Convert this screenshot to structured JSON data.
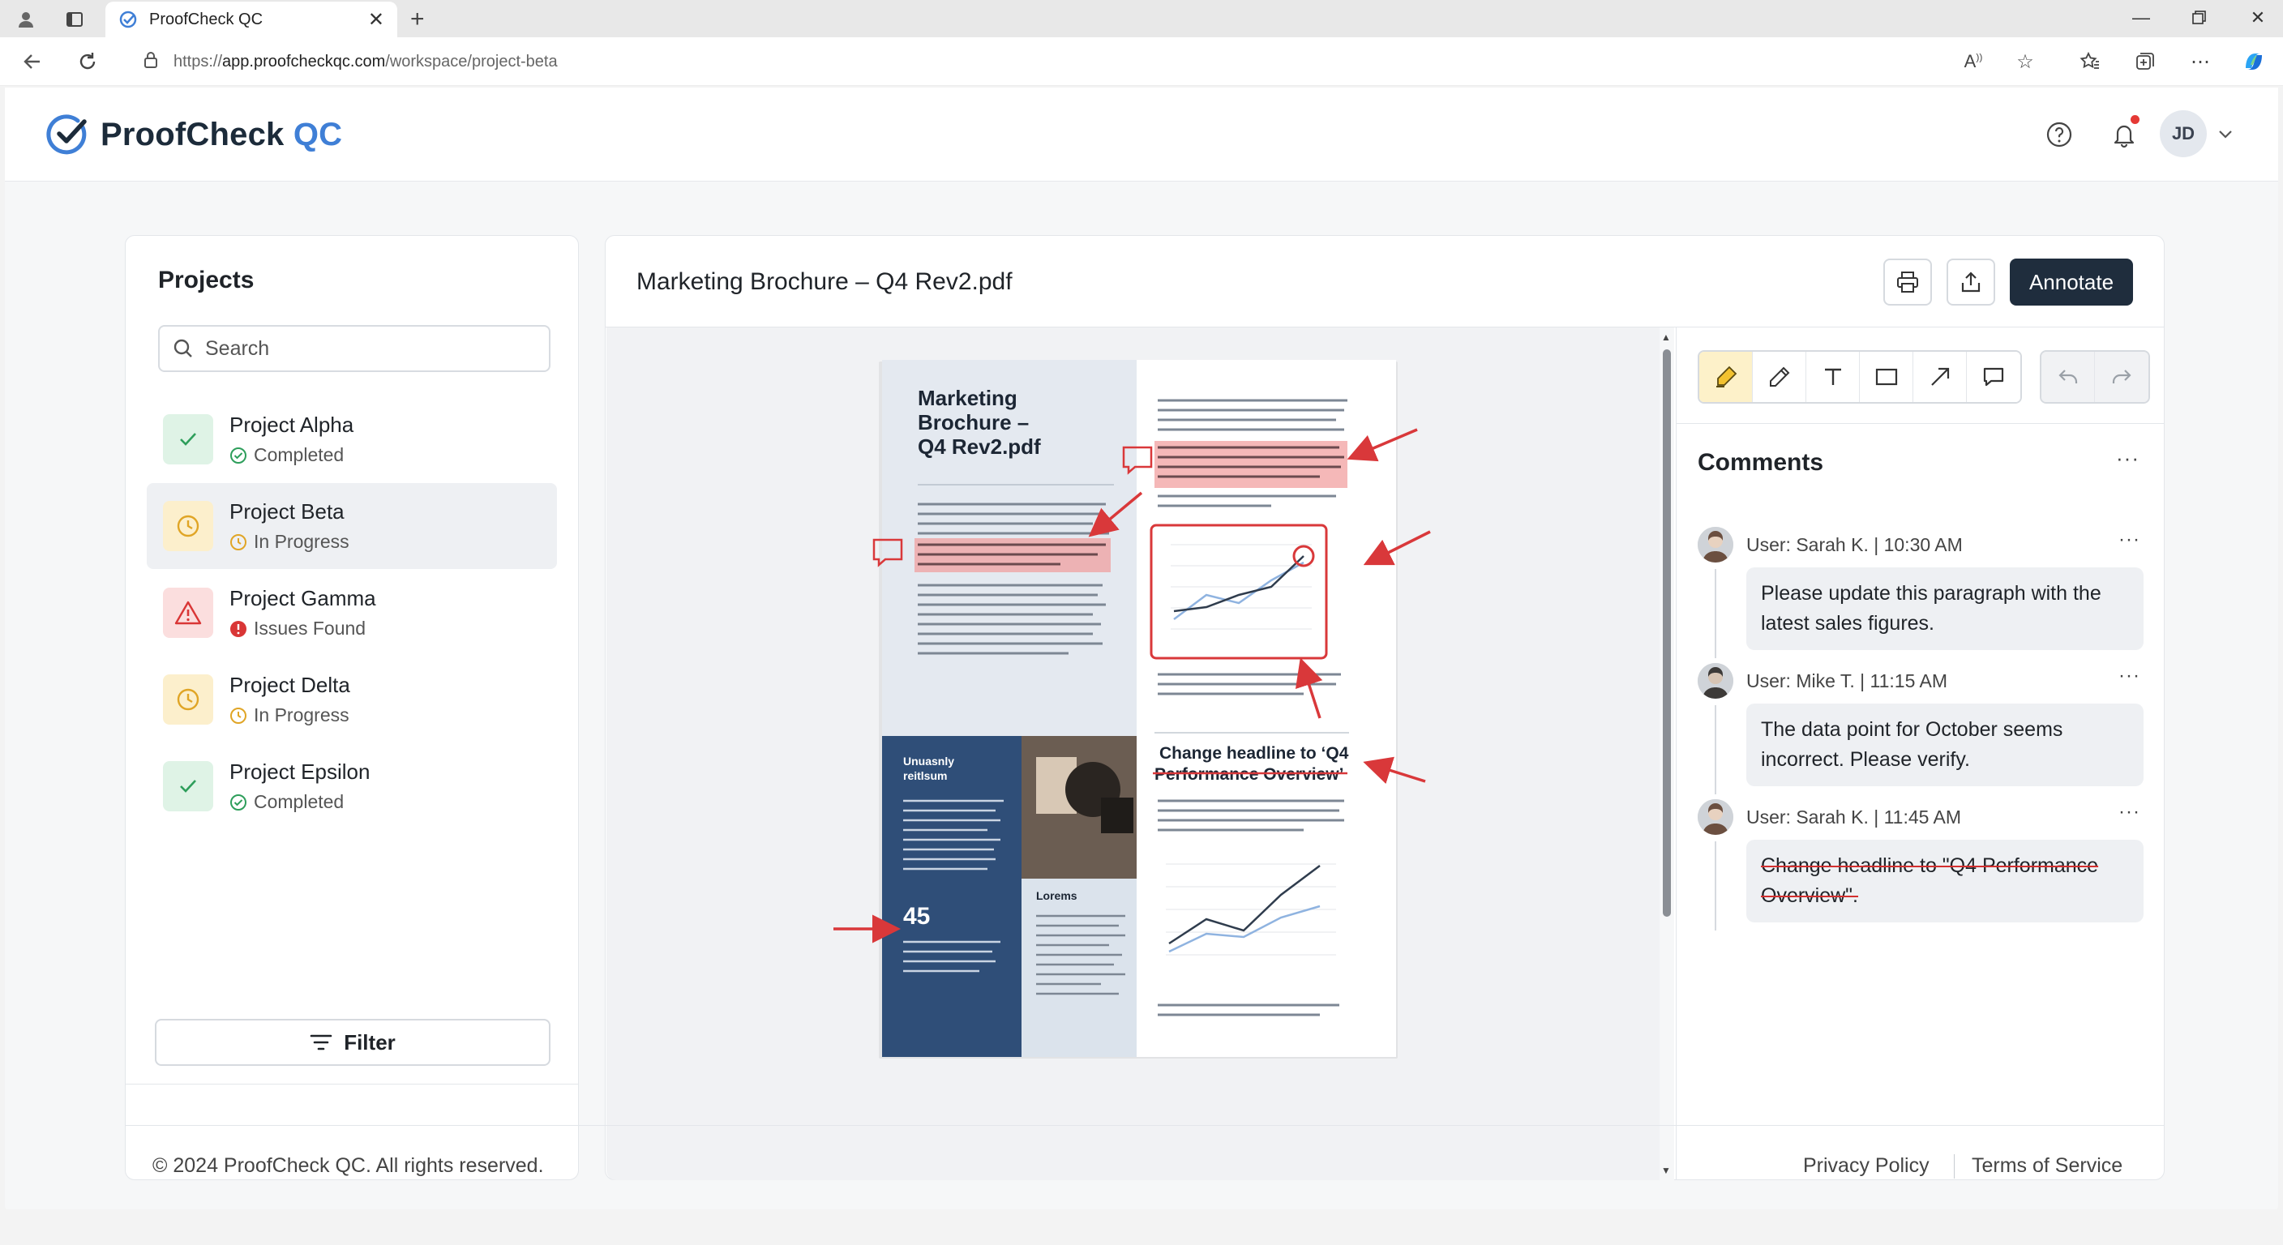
{
  "browser": {
    "tab_title": "ProofCheck QC",
    "url_prefix": "https://",
    "url_host": "app.proofcheckqc.com",
    "url_path": "/workspace/project-beta"
  },
  "app": {
    "brand_main": "ProofCheck",
    "brand_accent": "QC",
    "user_initials": "JD",
    "colors": {
      "accent": "#3f7fd6",
      "primary_button": "#1f2d3d",
      "success": "#2e9e5b",
      "warning": "#e0a526",
      "danger": "#d93636"
    }
  },
  "projects": {
    "title": "Projects",
    "search_placeholder": "Search",
    "items": [
      {
        "name": "Project Alpha",
        "status": "Completed",
        "state": "success"
      },
      {
        "name": "Project Beta",
        "status": "In Progress",
        "state": "warning"
      },
      {
        "name": "Project Gamma",
        "status": "Issues Found",
        "state": "danger"
      },
      {
        "name": "Project Delta",
        "status": "In Progress",
        "state": "warning"
      },
      {
        "name": "Project Epsilon",
        "status": "Completed",
        "state": "success"
      }
    ],
    "filter_label": "Filter"
  },
  "viewer": {
    "file_title": "Marketing Brochure – Q4 Rev2.pdf",
    "annotate_label": "Annotate",
    "document": {
      "title_lines": [
        "Marketing",
        "Brochure –",
        "Q4 Rev2.pdf"
      ],
      "headline_lines": [
        "Change headline to ‘Q4",
        "Performance Overview’"
      ],
      "sidebar_heading_lines": [
        "Unuasnly",
        "reitlsum"
      ],
      "big_stat": "45",
      "caption": "Lorems"
    }
  },
  "comments": {
    "title": "Comments",
    "items": [
      {
        "user": "User: Sarah K. | 10:30 AM",
        "text": "Please update this paragraph with the latest sales figures.",
        "strike": false
      },
      {
        "user": "User: Mike T. | 11:15 AM",
        "text": "The data point for October seems incorrect. Please verify.",
        "strike": false
      },
      {
        "user": "User: Sarah K. | 11:45 AM",
        "text": "Change headline to \"Q4 Performance Overview\".",
        "strike": true
      }
    ]
  },
  "footer": {
    "copyright": "© 2024 ProofCheck QC. All rights reserved.",
    "privacy": "Privacy Policy",
    "terms": "Terms of Service"
  }
}
